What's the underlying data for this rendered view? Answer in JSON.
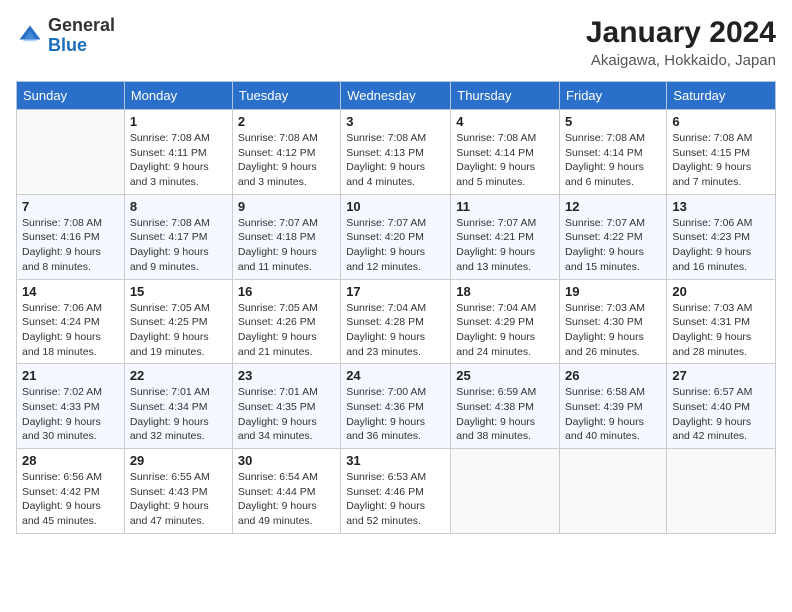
{
  "header": {
    "logo_general": "General",
    "logo_blue": "Blue",
    "month_title": "January 2024",
    "location": "Akaigawa, Hokkaido, Japan"
  },
  "days_of_week": [
    "Sunday",
    "Monday",
    "Tuesday",
    "Wednesday",
    "Thursday",
    "Friday",
    "Saturday"
  ],
  "weeks": [
    [
      {
        "day": "",
        "sunrise": "",
        "sunset": "",
        "daylight": ""
      },
      {
        "day": "1",
        "sunrise": "Sunrise: 7:08 AM",
        "sunset": "Sunset: 4:11 PM",
        "daylight": "Daylight: 9 hours and 3 minutes."
      },
      {
        "day": "2",
        "sunrise": "Sunrise: 7:08 AM",
        "sunset": "Sunset: 4:12 PM",
        "daylight": "Daylight: 9 hours and 3 minutes."
      },
      {
        "day": "3",
        "sunrise": "Sunrise: 7:08 AM",
        "sunset": "Sunset: 4:13 PM",
        "daylight": "Daylight: 9 hours and 4 minutes."
      },
      {
        "day": "4",
        "sunrise": "Sunrise: 7:08 AM",
        "sunset": "Sunset: 4:14 PM",
        "daylight": "Daylight: 9 hours and 5 minutes."
      },
      {
        "day": "5",
        "sunrise": "Sunrise: 7:08 AM",
        "sunset": "Sunset: 4:14 PM",
        "daylight": "Daylight: 9 hours and 6 minutes."
      },
      {
        "day": "6",
        "sunrise": "Sunrise: 7:08 AM",
        "sunset": "Sunset: 4:15 PM",
        "daylight": "Daylight: 9 hours and 7 minutes."
      }
    ],
    [
      {
        "day": "7",
        "sunrise": "Sunrise: 7:08 AM",
        "sunset": "Sunset: 4:16 PM",
        "daylight": "Daylight: 9 hours and 8 minutes."
      },
      {
        "day": "8",
        "sunrise": "Sunrise: 7:08 AM",
        "sunset": "Sunset: 4:17 PM",
        "daylight": "Daylight: 9 hours and 9 minutes."
      },
      {
        "day": "9",
        "sunrise": "Sunrise: 7:07 AM",
        "sunset": "Sunset: 4:18 PM",
        "daylight": "Daylight: 9 hours and 11 minutes."
      },
      {
        "day": "10",
        "sunrise": "Sunrise: 7:07 AM",
        "sunset": "Sunset: 4:20 PM",
        "daylight": "Daylight: 9 hours and 12 minutes."
      },
      {
        "day": "11",
        "sunrise": "Sunrise: 7:07 AM",
        "sunset": "Sunset: 4:21 PM",
        "daylight": "Daylight: 9 hours and 13 minutes."
      },
      {
        "day": "12",
        "sunrise": "Sunrise: 7:07 AM",
        "sunset": "Sunset: 4:22 PM",
        "daylight": "Daylight: 9 hours and 15 minutes."
      },
      {
        "day": "13",
        "sunrise": "Sunrise: 7:06 AM",
        "sunset": "Sunset: 4:23 PM",
        "daylight": "Daylight: 9 hours and 16 minutes."
      }
    ],
    [
      {
        "day": "14",
        "sunrise": "Sunrise: 7:06 AM",
        "sunset": "Sunset: 4:24 PM",
        "daylight": "Daylight: 9 hours and 18 minutes."
      },
      {
        "day": "15",
        "sunrise": "Sunrise: 7:05 AM",
        "sunset": "Sunset: 4:25 PM",
        "daylight": "Daylight: 9 hours and 19 minutes."
      },
      {
        "day": "16",
        "sunrise": "Sunrise: 7:05 AM",
        "sunset": "Sunset: 4:26 PM",
        "daylight": "Daylight: 9 hours and 21 minutes."
      },
      {
        "day": "17",
        "sunrise": "Sunrise: 7:04 AM",
        "sunset": "Sunset: 4:28 PM",
        "daylight": "Daylight: 9 hours and 23 minutes."
      },
      {
        "day": "18",
        "sunrise": "Sunrise: 7:04 AM",
        "sunset": "Sunset: 4:29 PM",
        "daylight": "Daylight: 9 hours and 24 minutes."
      },
      {
        "day": "19",
        "sunrise": "Sunrise: 7:03 AM",
        "sunset": "Sunset: 4:30 PM",
        "daylight": "Daylight: 9 hours and 26 minutes."
      },
      {
        "day": "20",
        "sunrise": "Sunrise: 7:03 AM",
        "sunset": "Sunset: 4:31 PM",
        "daylight": "Daylight: 9 hours and 28 minutes."
      }
    ],
    [
      {
        "day": "21",
        "sunrise": "Sunrise: 7:02 AM",
        "sunset": "Sunset: 4:33 PM",
        "daylight": "Daylight: 9 hours and 30 minutes."
      },
      {
        "day": "22",
        "sunrise": "Sunrise: 7:01 AM",
        "sunset": "Sunset: 4:34 PM",
        "daylight": "Daylight: 9 hours and 32 minutes."
      },
      {
        "day": "23",
        "sunrise": "Sunrise: 7:01 AM",
        "sunset": "Sunset: 4:35 PM",
        "daylight": "Daylight: 9 hours and 34 minutes."
      },
      {
        "day": "24",
        "sunrise": "Sunrise: 7:00 AM",
        "sunset": "Sunset: 4:36 PM",
        "daylight": "Daylight: 9 hours and 36 minutes."
      },
      {
        "day": "25",
        "sunrise": "Sunrise: 6:59 AM",
        "sunset": "Sunset: 4:38 PM",
        "daylight": "Daylight: 9 hours and 38 minutes."
      },
      {
        "day": "26",
        "sunrise": "Sunrise: 6:58 AM",
        "sunset": "Sunset: 4:39 PM",
        "daylight": "Daylight: 9 hours and 40 minutes."
      },
      {
        "day": "27",
        "sunrise": "Sunrise: 6:57 AM",
        "sunset": "Sunset: 4:40 PM",
        "daylight": "Daylight: 9 hours and 42 minutes."
      }
    ],
    [
      {
        "day": "28",
        "sunrise": "Sunrise: 6:56 AM",
        "sunset": "Sunset: 4:42 PM",
        "daylight": "Daylight: 9 hours and 45 minutes."
      },
      {
        "day": "29",
        "sunrise": "Sunrise: 6:55 AM",
        "sunset": "Sunset: 4:43 PM",
        "daylight": "Daylight: 9 hours and 47 minutes."
      },
      {
        "day": "30",
        "sunrise": "Sunrise: 6:54 AM",
        "sunset": "Sunset: 4:44 PM",
        "daylight": "Daylight: 9 hours and 49 minutes."
      },
      {
        "day": "31",
        "sunrise": "Sunrise: 6:53 AM",
        "sunset": "Sunset: 4:46 PM",
        "daylight": "Daylight: 9 hours and 52 minutes."
      },
      {
        "day": "",
        "sunrise": "",
        "sunset": "",
        "daylight": ""
      },
      {
        "day": "",
        "sunrise": "",
        "sunset": "",
        "daylight": ""
      },
      {
        "day": "",
        "sunrise": "",
        "sunset": "",
        "daylight": ""
      }
    ]
  ]
}
